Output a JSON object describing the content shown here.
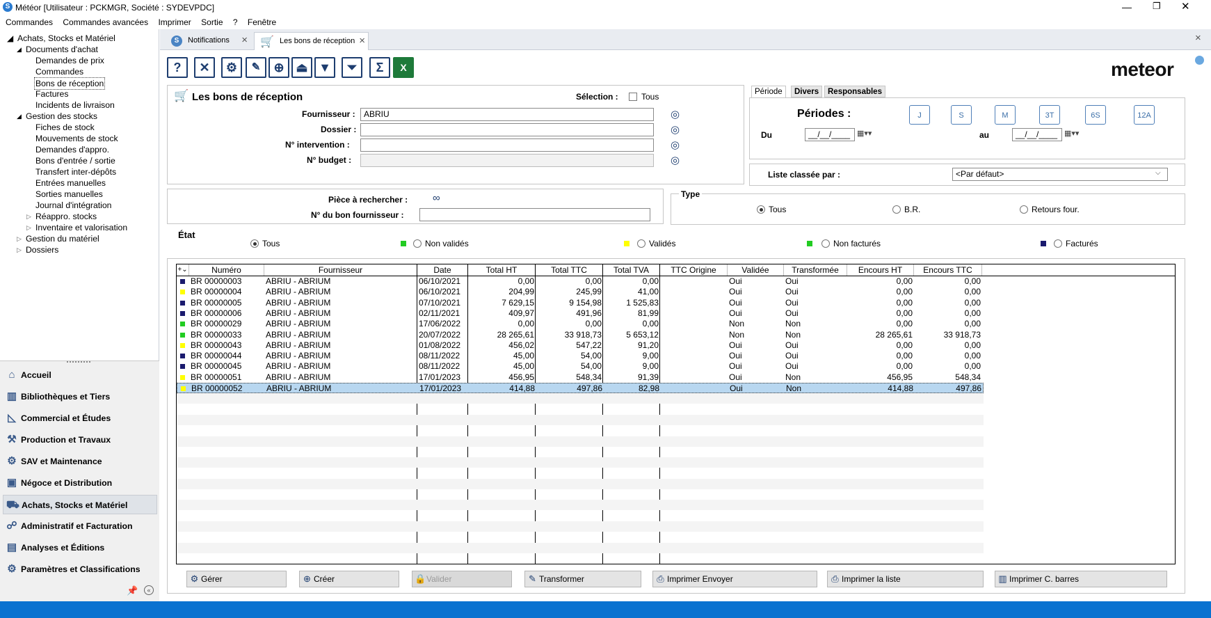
{
  "window": {
    "title": "Météor [Utilisateur : PCKMGR, Société : SYDEVPDC]"
  },
  "menu": [
    "Commandes",
    "Commandes avancées",
    "Imprimer",
    "Sortie",
    "?",
    "Fenêtre"
  ],
  "tree": {
    "root": "Achats, Stocks et Matériel",
    "docs": "Documents d'achat",
    "docs_items": [
      "Demandes de prix",
      "Commandes",
      "Bons de réception",
      "Factures",
      "Incidents de livraison"
    ],
    "stock": "Gestion des stocks",
    "stock_items": [
      "Fiches de stock",
      "Mouvements de stock",
      "Demandes d'appro.",
      "Bons d'entrée / sortie",
      "Transfert inter-dépôts",
      "Entrées manuelles",
      "Sorties manuelles",
      "Journal d'intégration"
    ],
    "stock_sub": [
      "Réappro. stocks",
      "Inventaire et valorisation"
    ],
    "mat": "Gestion du matériel",
    "dossiers": "Dossiers"
  },
  "modules": [
    "Accueil",
    "Bibliothèques et Tiers",
    "Commercial et Études",
    "Production et Travaux",
    "SAV et Maintenance",
    "Négoce et Distribution",
    "Achats, Stocks et Matériel",
    "Administratif et Facturation",
    "Analyses et Éditions",
    "Paramètres et Classifications"
  ],
  "tabs": {
    "notifications": "Notifications",
    "active": "Les bons de réception"
  },
  "brand": "meteor",
  "form": {
    "title": "Les bons de réception",
    "selection_label": "Sélection :",
    "selection_all": "Tous",
    "fournisseur_label": "Fournisseur :",
    "fournisseur_value": "ABRIU",
    "dossier_label": "Dossier :",
    "intervention_label": "N° intervention :",
    "budget_label": "N° budget :",
    "piece_label": "Pièce à rechercher :",
    "bon_fournisseur_label": "N° du bon fournisseur :"
  },
  "periode": {
    "tabs": [
      "Période",
      "Divers",
      "Responsables"
    ],
    "title": "Périodes :",
    "du": "Du",
    "au": "au",
    "date_placeholder": "__/__/____",
    "cal_icons": [
      "J",
      "S",
      "M",
      "T",
      "S",
      "A"
    ],
    "cal_nums": [
      "",
      "",
      "",
      "3",
      "6",
      "12"
    ]
  },
  "tri": {
    "label": "Liste classée par :",
    "value": "<Par défaut>"
  },
  "type": {
    "label": "Type",
    "options": [
      "Tous",
      "B.R.",
      "Retours four."
    ]
  },
  "etat": {
    "label": "État",
    "options": [
      "Tous",
      "Non validés",
      "Validés",
      "Non facturés",
      "Facturés"
    ]
  },
  "colors": {
    "navy": "#1a1a6e",
    "yellow": "#ffff00",
    "green": "#22cc22",
    "selected": "#b8d7f0"
  },
  "grid": {
    "headers": [
      "Numéro",
      "Fournisseur",
      "Date",
      "Total HT",
      "Total TTC",
      "Total TVA",
      "TTC Origine",
      "Validée",
      "Transformée",
      "Encours HT",
      "Encours TTC"
    ],
    "rows": [
      {
        "c": "navy",
        "n": "BR 00000003",
        "f": "ABRIU - ABRIUM",
        "d": "06/10/2021",
        "ht": "0,00",
        "ttc": "0,00",
        "tva": "0,00",
        "v": "Oui",
        "t": "Oui",
        "eht": "0,00",
        "ettc": "0,00"
      },
      {
        "c": "yellow",
        "n": "BR 00000004",
        "f": "ABRIU - ABRIUM",
        "d": "06/10/2021",
        "ht": "204,99",
        "ttc": "245,99",
        "tva": "41,00",
        "v": "Oui",
        "t": "Oui",
        "eht": "0,00",
        "ettc": "0,00"
      },
      {
        "c": "navy",
        "n": "BR 00000005",
        "f": "ABRIU - ABRIUM",
        "d": "07/10/2021",
        "ht": "7 629,15",
        "ttc": "9 154,98",
        "tva": "1 525,83",
        "v": "Oui",
        "t": "Oui",
        "eht": "0,00",
        "ettc": "0,00"
      },
      {
        "c": "navy",
        "n": "BR 00000006",
        "f": "ABRIU - ABRIUM",
        "d": "02/11/2021",
        "ht": "409,97",
        "ttc": "491,96",
        "tva": "81,99",
        "v": "Oui",
        "t": "Oui",
        "eht": "0,00",
        "ettc": "0,00"
      },
      {
        "c": "green",
        "n": "BR 00000029",
        "f": "ABRIU - ABRIUM",
        "d": "17/06/2022",
        "ht": "0,00",
        "ttc": "0,00",
        "tva": "0,00",
        "v": "Non",
        "t": "Non",
        "eht": "0,00",
        "ettc": "0,00"
      },
      {
        "c": "green",
        "n": "BR 00000033",
        "f": "ABRIU - ABRIUM",
        "d": "20/07/2022",
        "ht": "28 265,61",
        "ttc": "33 918,73",
        "tva": "5 653,12",
        "v": "Non",
        "t": "Non",
        "eht": "28 265,61",
        "ettc": "33 918,73"
      },
      {
        "c": "yellow",
        "n": "BR 00000043",
        "f": "ABRIU - ABRIUM",
        "d": "01/08/2022",
        "ht": "456,02",
        "ttc": "547,22",
        "tva": "91,20",
        "v": "Oui",
        "t": "Oui",
        "eht": "0,00",
        "ettc": "0,00"
      },
      {
        "c": "navy",
        "n": "BR 00000044",
        "f": "ABRIU - ABRIUM",
        "d": "08/11/2022",
        "ht": "45,00",
        "ttc": "54,00",
        "tva": "9,00",
        "v": "Oui",
        "t": "Oui",
        "eht": "0,00",
        "ettc": "0,00"
      },
      {
        "c": "navy",
        "n": "BR 00000045",
        "f": "ABRIU - ABRIUM",
        "d": "08/11/2022",
        "ht": "45,00",
        "ttc": "54,00",
        "tva": "9,00",
        "v": "Oui",
        "t": "Oui",
        "eht": "0,00",
        "ettc": "0,00"
      },
      {
        "c": "yellow",
        "n": "BR 00000051",
        "f": "ABRIU - ABRIUM",
        "d": "17/01/2023",
        "ht": "456,95",
        "ttc": "548,34",
        "tva": "91,39",
        "v": "Oui",
        "t": "Non",
        "eht": "456,95",
        "ettc": "548,34"
      },
      {
        "c": "yellow",
        "n": "BR 00000052",
        "f": "ABRIU - ABRIUM",
        "d": "17/01/2023",
        "ht": "414,88",
        "ttc": "497,86",
        "tva": "82,98",
        "v": "Oui",
        "t": "Non",
        "eht": "414,88",
        "ettc": "497,86",
        "sel": true
      }
    ]
  },
  "actions": [
    "Gérer",
    "Créer",
    "Valider",
    "Transformer",
    "Imprimer Envoyer",
    "Imprimer la liste",
    "Imprimer C. barres"
  ]
}
